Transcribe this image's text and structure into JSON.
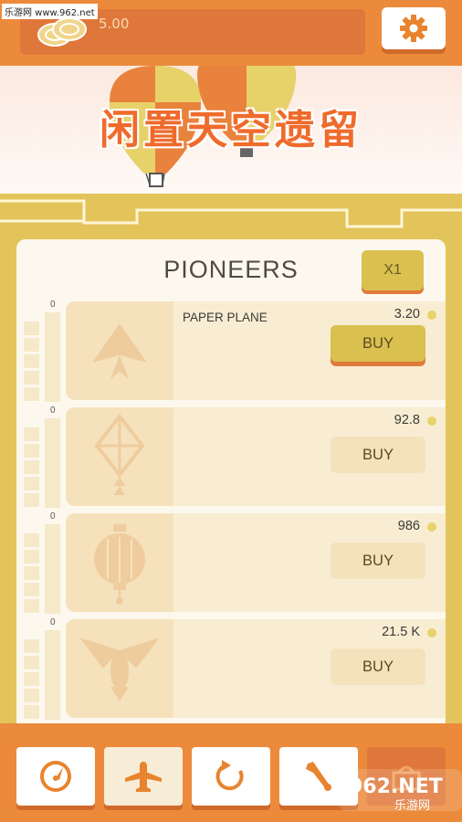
{
  "watermark": {
    "top_text": "乐游网 www.962.net",
    "bottom_big": "962.NET",
    "bottom_small": "乐游网"
  },
  "header": {
    "coins": "5.00",
    "settings_icon": "gear-icon"
  },
  "banner": {
    "title": "闲置天空遗留"
  },
  "panel": {
    "title": "PIONEERS",
    "multiplier_label": "X1",
    "items": [
      {
        "count": "0",
        "name": "PAPER PLANE",
        "price": "3.20",
        "buy_label": "BUY",
        "icon": "paper-plane-icon",
        "active": true
      },
      {
        "count": "0",
        "name": "",
        "price": "92.8",
        "buy_label": "BUY",
        "icon": "kite-icon",
        "active": false
      },
      {
        "count": "0",
        "name": "",
        "price": "986",
        "buy_label": "BUY",
        "icon": "lantern-icon",
        "active": false
      },
      {
        "count": "0",
        "name": "",
        "price": "21.5 K",
        "buy_label": "BUY",
        "icon": "glider-bird-icon",
        "active": false
      }
    ]
  },
  "bottom_nav": [
    {
      "icon": "compass-icon",
      "state": "normal"
    },
    {
      "icon": "airplane-icon",
      "state": "active"
    },
    {
      "icon": "refresh-icon",
      "state": "normal"
    },
    {
      "icon": "wrench-icon",
      "state": "normal"
    },
    {
      "icon": "shopping-basket-icon",
      "state": "disabled"
    }
  ],
  "colors": {
    "accent_orange": "#ec8a3c",
    "gold": "#e3c45a",
    "panel_bg": "#fdf8ee",
    "title_orange": "#ef6b2c"
  }
}
